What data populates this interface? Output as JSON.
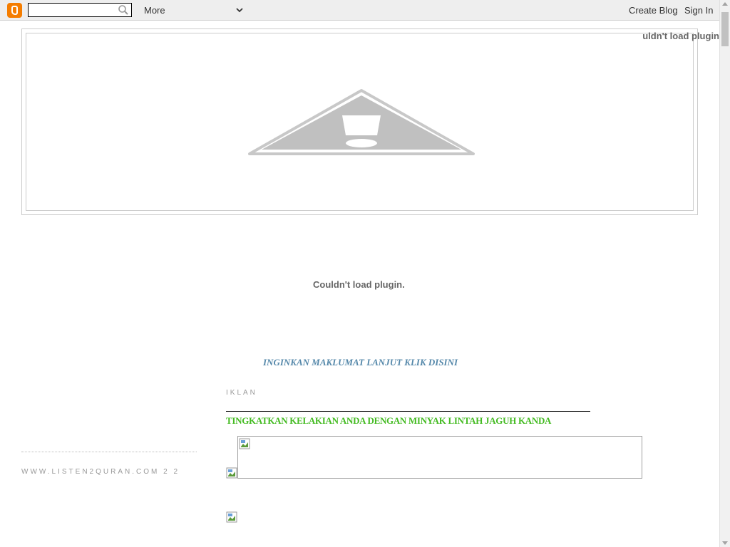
{
  "navbar": {
    "logo_icon": "blogger-logo-icon",
    "search_placeholder": "",
    "search_value": "",
    "more_label": "More",
    "create_blog_label": "Create Blog",
    "sign_in_label": "Sign In"
  },
  "header": {
    "plugin_error_corner": "Couldn't load plugin."
  },
  "main": {
    "plugin_error": "Couldn't load plugin.",
    "info_link": "INGINKAN MAKLUMAT LANJUT KLIK DISINI",
    "section_title": "IKLAN",
    "promo_link": "TINGKATKAN KELAKIAN ANDA DENGAN MINYAK LINTAH JAGUH KANDA"
  },
  "sidebar": {
    "link": "WWW.LISTEN2QURAN.COM 2 2"
  },
  "colors": {
    "accent_logo": "#f57d00",
    "info_link": "#5588aa",
    "promo_link": "#44bb22"
  }
}
